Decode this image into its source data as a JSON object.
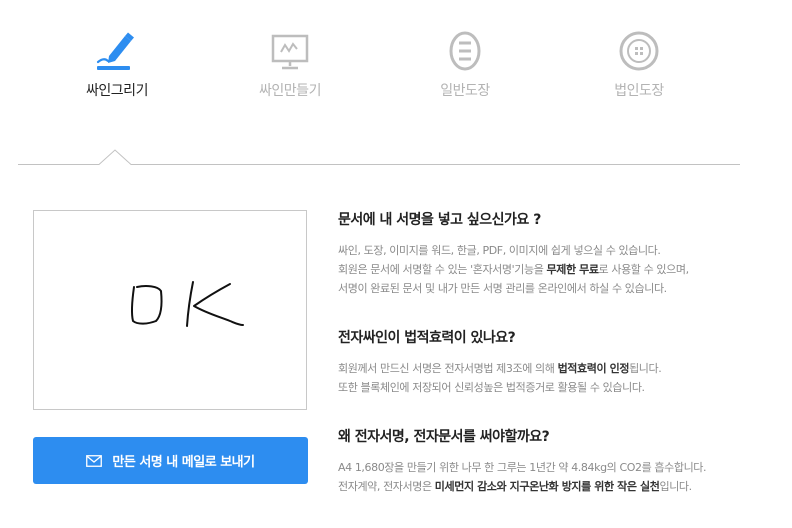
{
  "tabs": [
    {
      "label": "싸인그리기",
      "icon": "pen-icon",
      "active": true
    },
    {
      "label": "싸인만들기",
      "icon": "monitor-signature-icon",
      "active": false
    },
    {
      "label": "일반도장",
      "icon": "oval-stamp-icon",
      "active": false
    },
    {
      "label": "법인도장",
      "icon": "round-seal-icon",
      "active": false
    }
  ],
  "send_button": {
    "label": "만든 서명 내 메일로 보내기",
    "icon": "mail-icon"
  },
  "faq": [
    {
      "question": "문서에 내 서명을 넣고 싶으신가요 ?",
      "line1": "싸인, 도장, 이미지를 워드, 한글, PDF, 이미지에 쉽게 넣으실 수 있습니다.",
      "line2_pre": "회원은 문서에 서명할 수 있는 '혼자서명'기능을 ",
      "line2_bold": "무제한 무료",
      "line2_post": "로 사용할 수 있으며,",
      "line3": "서명이 완료된 문서 및 내가 만든 서명 관리를 온라인에서 하실 수 있습니다."
    },
    {
      "question": "전자싸인이 법적효력이 있나요?",
      "line1_pre": "회원께서 만드신 서명은 전자서명법 제3조에 의해 ",
      "line1_bold": "법적효력이 인정",
      "line1_post": "됩니다.",
      "line2": "또한 블록체인에 저장되어 신뢰성높은 법적증거로 활용될 수 있습니다."
    },
    {
      "question": "왜 전자서명, 전자문서를 써야할까요?",
      "line1": "A4 1,680장을 만들기 위한 나무 한 그루는 1년간 약 4.84kg의 CO2를 흡수합니다.",
      "line2_pre": "전자계약, 전자서명은 ",
      "line2_bold": "미세먼지 감소와 지구온난화 방지를 위한 작은 실천",
      "line2_post": "입니다."
    }
  ],
  "colors": {
    "accent": "#2d8df0",
    "inactive": "#b3b3b3",
    "text_muted": "#8a8a8a"
  }
}
